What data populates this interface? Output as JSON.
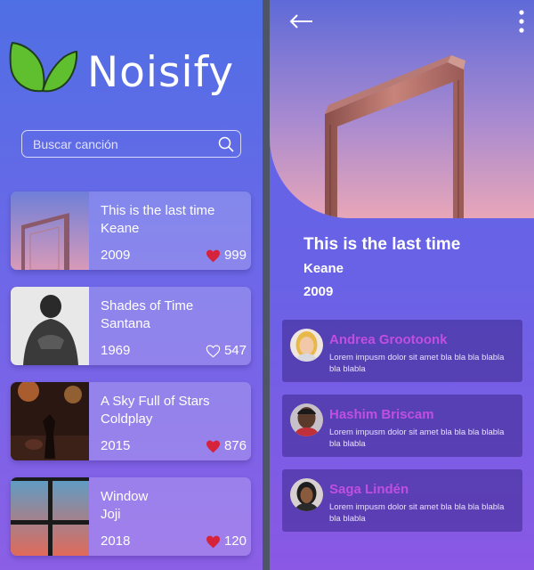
{
  "app": {
    "brand": "Noisify"
  },
  "colors": {
    "accent_name": "#c04fe0",
    "heart_filled": "#d6233c",
    "leaf": "#5fbf2e"
  },
  "search": {
    "placeholder": "Buscar canción",
    "value": ""
  },
  "songs": [
    {
      "title": "This is the last time",
      "artist": "Keane",
      "year": "2009",
      "likes": "999",
      "liked": true,
      "thumb": "dubai-frame"
    },
    {
      "title": "Shades of Time",
      "artist": "Santana",
      "year": "1969",
      "likes": "547",
      "liked": false,
      "thumb": "bw-man"
    },
    {
      "title": "A Sky Full of Stars",
      "artist": "Coldplay",
      "year": "2015",
      "likes": "876",
      "liked": true,
      "thumb": "concert"
    },
    {
      "title": "Window",
      "artist": "Joji",
      "year": "2018",
      "likes": "120",
      "liked": true,
      "thumb": "window"
    }
  ],
  "detail": {
    "title": "This is the last time",
    "artist": "Keane",
    "year": "2009",
    "icons": {
      "back": "back-arrow-icon",
      "menu": "more-vertical-icon"
    }
  },
  "comments": [
    {
      "name": "Andrea Grootoonk",
      "text": "Lorem impusm dolor sit amet bla bla bla blabla bla blabla"
    },
    {
      "name": "Hashim Briscam",
      "text": "Lorem impusm dolor sit amet bla bla bla blabla bla blabla"
    },
    {
      "name": "Saga Lindén",
      "text": "Lorem impusm dolor sit amet bla bla bla blabla bla blabla"
    }
  ]
}
